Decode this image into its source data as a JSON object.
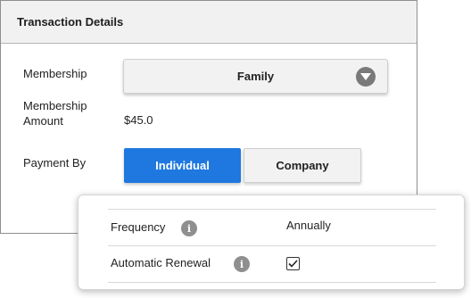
{
  "card": {
    "title": "Transaction Details"
  },
  "membership": {
    "label": "Membership",
    "selected": "Family",
    "caret_icon": "chevron-down-icon"
  },
  "amount": {
    "label_line1": "Membership",
    "label_line2": "Amount",
    "value": "$45.0"
  },
  "payment": {
    "label": "Payment By",
    "options": [
      "Individual",
      "Company"
    ],
    "selected": "Individual"
  },
  "details_panel": {
    "frequency_label": "Frequency",
    "frequency_value": "Annually",
    "renewal_label": "Automatic Renewal",
    "renewal_checked": true,
    "info_icon_glyph": "i"
  },
  "colors": {
    "accent": "#1f78e0",
    "header_bg": "#f1f1f1",
    "icon_gray": "#8f8f8f"
  }
}
